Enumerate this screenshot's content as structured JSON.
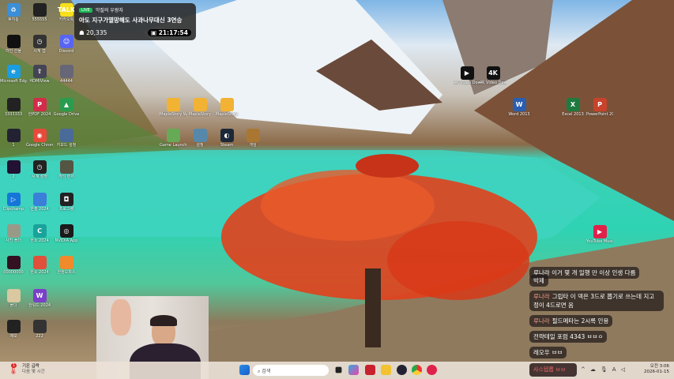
{
  "desktop_icons": [
    {
      "label": "휴지통",
      "color": "#3a8fd8",
      "glyph": "♻"
    },
    {
      "label": "555555",
      "color": "#222"
    },
    {
      "label": "카카오톡",
      "color": "#f7e01b",
      "glyph": "TALK"
    },
    {
      "label": "라인 선물",
      "color": "#111"
    },
    {
      "label": "시계 앱",
      "color": "#333",
      "glyph": "◷"
    },
    {
      "label": "Discord",
      "color": "#5865f2",
      "glyph": "☺"
    },
    {
      "label": "Microsoft Edge",
      "color": "#1b9de2",
      "glyph": "e"
    },
    {
      "label": "HDMIView",
      "color": "#445",
      "glyph": "⇧"
    },
    {
      "label": "44444",
      "color": "#667"
    },
    {
      "label": "3333333",
      "color": "#222"
    },
    {
      "label": "한PDF 2024",
      "color": "#d22c4a",
      "glyph": "P"
    },
    {
      "label": "Google Drive",
      "color": "#2a9c4f",
      "glyph": "▲"
    },
    {
      "label": "1",
      "color": "#223"
    },
    {
      "label": "Google Chrome",
      "color": "#e64a3a",
      "glyph": "◉"
    },
    {
      "label": "키보드 설정",
      "color": "#4a6a9a"
    },
    {
      "label": "2",
      "color": "#213"
    },
    {
      "label": "시계 설정",
      "color": "#222",
      "glyph": "◷"
    },
    {
      "label": "게임 런처",
      "color": "#554"
    },
    {
      "label": "Clipchamp",
      "color": "#1676d8",
      "glyph": "▷"
    },
    {
      "label": "한셀 2024",
      "color": "#3a7fd8"
    },
    {
      "label": "프로그램",
      "color": "#222",
      "glyph": "◘"
    },
    {
      "label": "사진 폴더",
      "color": "#998"
    },
    {
      "label": "한쇼 2024",
      "color": "#1aa39a",
      "glyph": "C"
    },
    {
      "label": "NVIDIA App",
      "color": "#1a1a1a",
      "glyph": "◎"
    },
    {
      "label": "00000000",
      "color": "#312"
    },
    {
      "label": "한쇼 2024",
      "color": "#e0503a"
    },
    {
      "label": "한컴오피스",
      "color": "#f08a2a"
    },
    {
      "label": "폴더",
      "color": "#d9c8a0"
    },
    {
      "label": "한워드 2024",
      "color": "#7b3fc9",
      "glyph": "W"
    },
    {
      "label": "메모",
      "color": "#222"
    },
    {
      "label": "222",
      "color": "#333"
    }
  ],
  "middle_icons": [
    {
      "label": "MapleStory Worlds",
      "color": "#f2b233"
    },
    {
      "label": "MapleStory",
      "color": "#f2b233"
    },
    {
      "label": "MapleStory",
      "color": "#f2b233"
    },
    {
      "label": "Game Launcher",
      "color": "#6a5"
    },
    {
      "label": "설정",
      "color": "#58a"
    },
    {
      "label": "Steam",
      "color": "#1b2838",
      "glyph": "◐"
    },
    {
      "label": "게임",
      "color": "#a73"
    }
  ],
  "right_icons": [
    {
      "label": "4K Video Downloader",
      "color": "#111",
      "glyph": "▶"
    },
    {
      "label": "4K Video Downloader Plus",
      "color": "#111",
      "glyph": "4K"
    },
    {
      "label": "Word 2013",
      "color": "#2b5eb0",
      "glyph": "W"
    },
    {
      "label": "Excel 2013",
      "color": "#1f7a40",
      "glyph": "X"
    },
    {
      "label": "PowerPoint 2013",
      "color": "#c8432b",
      "glyph": "P"
    },
    {
      "label": "YouTube Music",
      "color": "#e0224a",
      "glyph": "▶"
    }
  ],
  "notification": {
    "badge": "LIVE",
    "channel": "악질의 우왕자",
    "title": "아도 지구가멸망해도 사과나무대신 3연승",
    "viewers": "20,335",
    "time": "21:17:54"
  },
  "chat": [
    {
      "name": "",
      "text": "루나라 이거 몇 개 일행 만 이상 인생 다름"
    },
    {
      "name": "",
      "text": "박제"
    },
    {
      "name": "루나라",
      "text": "그립타 이 덱은 3드로 뽑기로 쓰는데 지고정이 4드로면 옴"
    },
    {
      "name": "루나라",
      "text": "필드메타는 2시록 인용"
    },
    {
      "name": "",
      "text": "전략테일 포럼 4343 ㅂㅂㅇ"
    },
    {
      "name": "",
      "text": "레오우 ㅂㅂ"
    },
    {
      "name": "",
      "text": "사스텝롭 ㅂㅂ"
    }
  ],
  "taskbar": {
    "weather_line1": "기온 급락",
    "weather_line2": "다음 몇 시간",
    "weather_badge": "1",
    "search_placeholder": "검색",
    "time": "오전 3:06",
    "date": "2026-01-15"
  }
}
